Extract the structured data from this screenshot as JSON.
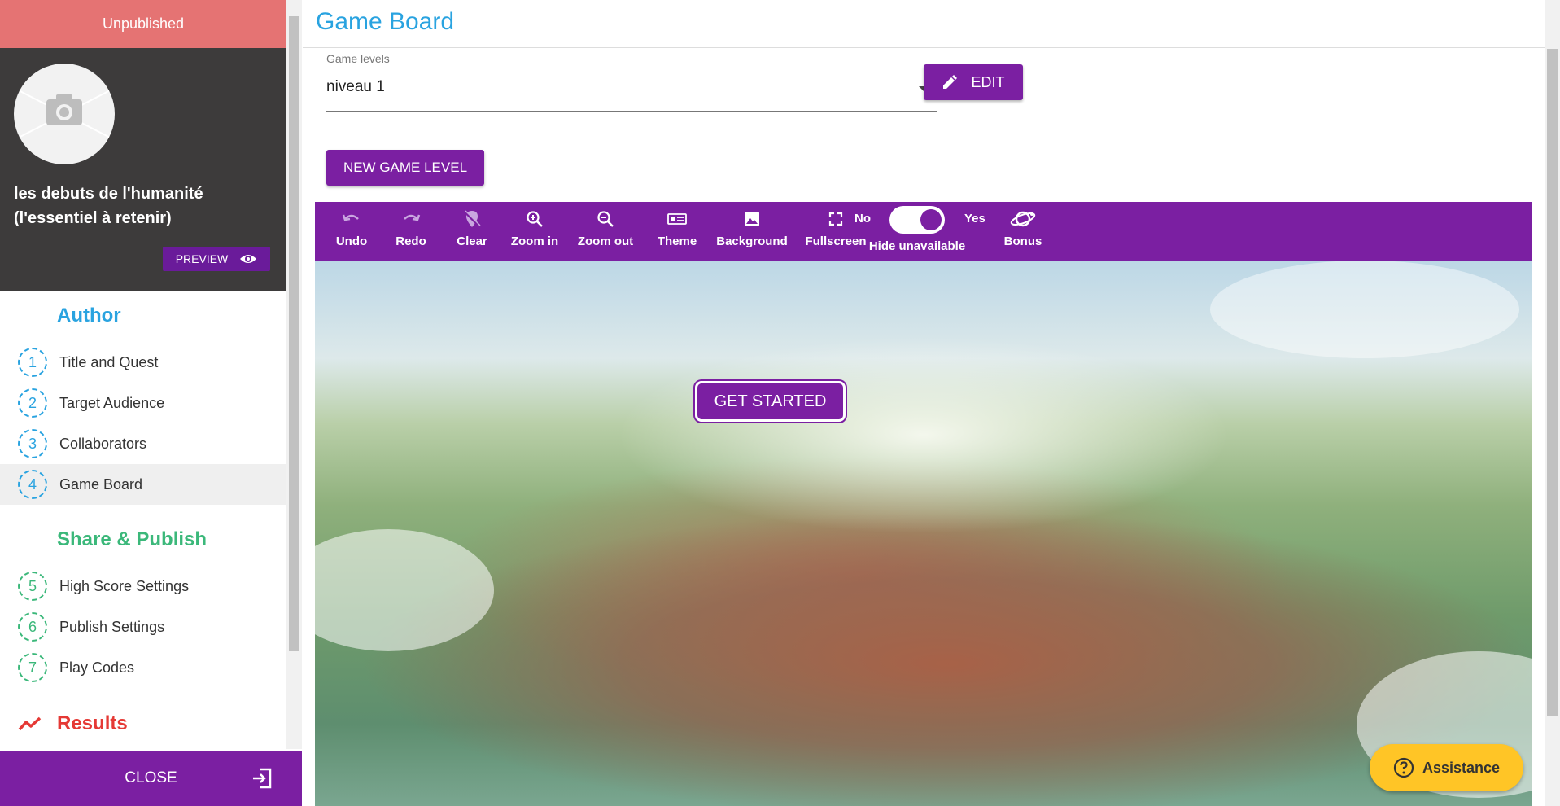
{
  "sidebar": {
    "status": "Unpublished",
    "project": {
      "title": "les debuts de l'humanité (l'essentiel à retenir)",
      "preview_label": "PREVIEW"
    },
    "author_section": {
      "title": "Author",
      "color": "#29a3e0",
      "items": [
        {
          "num": "1",
          "label": "Title and Quest"
        },
        {
          "num": "2",
          "label": "Target Audience"
        },
        {
          "num": "3",
          "label": "Collaborators"
        },
        {
          "num": "4",
          "label": "Game Board"
        }
      ]
    },
    "share_section": {
      "title": "Share & Publish",
      "color": "#3bb87a",
      "items": [
        {
          "num": "5",
          "label": "High Score Settings"
        },
        {
          "num": "6",
          "label": "Publish Settings"
        },
        {
          "num": "7",
          "label": "Play Codes"
        }
      ]
    },
    "results": {
      "title": "Results",
      "color": "#e53935"
    },
    "close_label": "CLOSE"
  },
  "main": {
    "title": "Game Board",
    "levels": {
      "label": "Game levels",
      "value": "niveau 1"
    },
    "edit_label": "EDIT",
    "new_level_label": "NEW GAME LEVEL",
    "toolbar": {
      "undo": "Undo",
      "redo": "Redo",
      "clear": "Clear",
      "zoom_in": "Zoom in",
      "zoom_out": "Zoom out",
      "theme": "Theme",
      "background": "Background",
      "fullscreen": "Fullscreen",
      "toggle_no": "No",
      "toggle_yes": "Yes",
      "hide_unavailable": "Hide unavailable",
      "bonus": "Bonus"
    },
    "get_started_label": "GET STARTED"
  },
  "assistance_label": "Assistance",
  "colors": {
    "accent": "#7b1fa2",
    "title": "#29a3e0",
    "status": "#e57373"
  }
}
